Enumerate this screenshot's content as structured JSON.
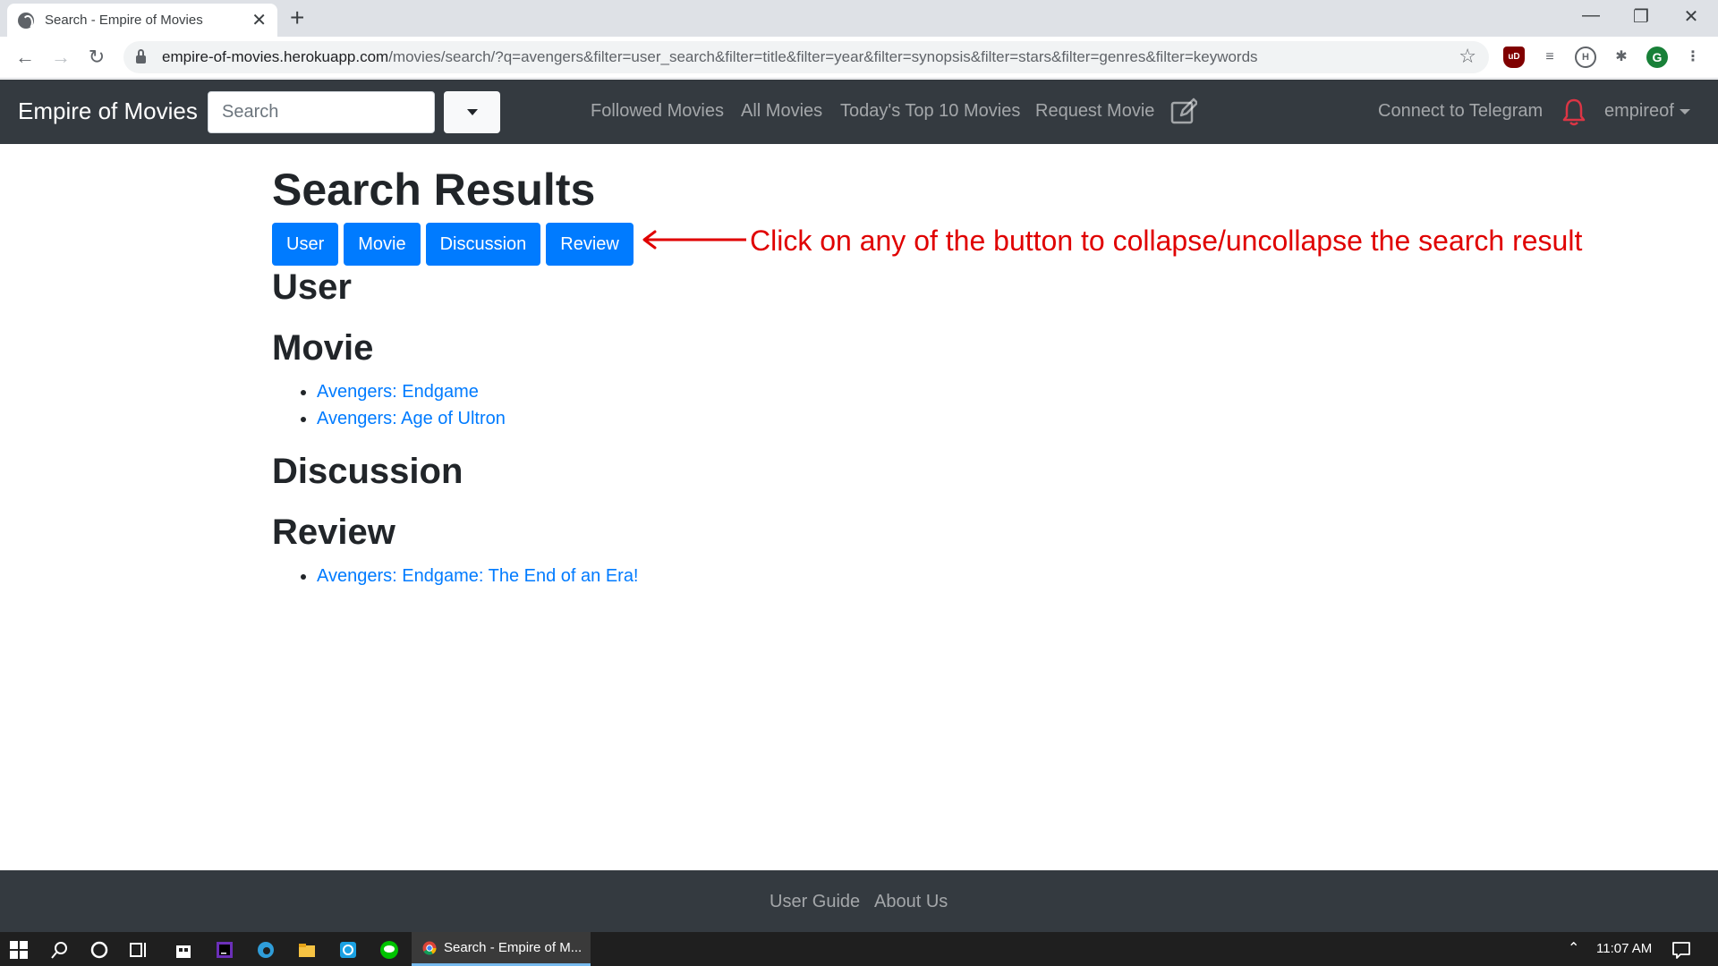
{
  "browser": {
    "tab_title": "Search - Empire of Movies",
    "url_host": "empire-of-movies.herokuapp.com",
    "url_path": "/movies/search/?q=avengers&filter=user_search&filter=title&filter=year&filter=synopsis&filter=stars&filter=genres&filter=keywords",
    "profile_initial": "G",
    "ublock_label": "uD",
    "ext_h_label": "H"
  },
  "navbar": {
    "brand": "Empire of Movies",
    "search_placeholder": "Search",
    "links": {
      "followed": "Followed Movies",
      "all": "All Movies",
      "top10": "Today's Top 10 Movies",
      "request": "Request Movie"
    },
    "telegram": "Connect to Telegram",
    "username": "empireof"
  },
  "main": {
    "title": "Search Results",
    "buttons": {
      "user": "User",
      "movie": "Movie",
      "discussion": "Discussion",
      "review": "Review"
    },
    "sections": {
      "user": {
        "heading": "User",
        "items": []
      },
      "movie": {
        "heading": "Movie",
        "items": [
          "Avengers: Endgame",
          "Avengers: Age of Ultron"
        ]
      },
      "discussion": {
        "heading": "Discussion",
        "items": []
      },
      "review": {
        "heading": "Review",
        "items": [
          "Avengers: Endgame: The End of an Era!"
        ]
      }
    }
  },
  "annotation": {
    "text": "Click on any of the button to collapse/uncollapse the search result",
    "color": "#e00000"
  },
  "footer": {
    "user_guide": "User Guide",
    "about_us": "About Us"
  },
  "taskbar": {
    "app_label": "Search - Empire of M...",
    "clock": "11:07 AM"
  },
  "colors": {
    "navbar_bg": "#343a40",
    "primary": "#007bff",
    "link": "#007bff"
  }
}
